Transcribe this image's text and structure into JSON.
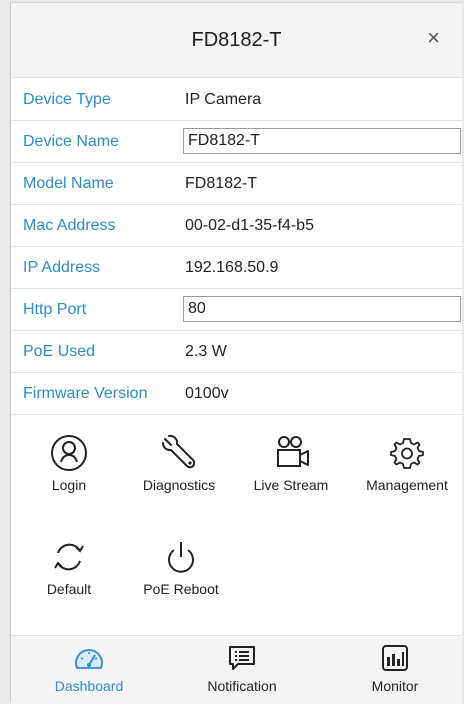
{
  "dialog": {
    "title": "FD8182-T",
    "close_glyph": "×"
  },
  "rows": [
    {
      "label": "Device Type",
      "value": "IP Camera"
    },
    {
      "label": "Device Name",
      "value": "FD8182-T"
    },
    {
      "label": "Model Name",
      "value": "FD8182-T"
    },
    {
      "label": "Mac Address",
      "value": "00-02-d1-35-f4-b5"
    },
    {
      "label": "IP Address",
      "value": "192.168.50.9"
    },
    {
      "label": "Http Port",
      "value": "80"
    },
    {
      "label": "PoE Used",
      "value": "2.3 W"
    },
    {
      "label": "Firmware Version",
      "value": "0100v"
    }
  ],
  "actions": [
    {
      "label": "Login",
      "icon": "user-circle-icon"
    },
    {
      "label": "Diagnostics",
      "icon": "wrench-icon"
    },
    {
      "label": "Live Stream",
      "icon": "video-camera-icon"
    },
    {
      "label": "Management",
      "icon": "gear-icon"
    },
    {
      "label": "Default",
      "icon": "reset-arrows-icon"
    },
    {
      "label": "PoE Reboot",
      "icon": "power-icon"
    }
  ],
  "tabs": [
    {
      "label": "Dashboard",
      "icon": "gauge-icon",
      "active": true
    },
    {
      "label": "Notification",
      "icon": "message-list-icon",
      "active": false
    },
    {
      "label": "Monitor",
      "icon": "chart-monitor-icon",
      "active": false
    }
  ],
  "colors": {
    "accent": "#2e8bc7",
    "header_bg": "#f4f4f4"
  }
}
